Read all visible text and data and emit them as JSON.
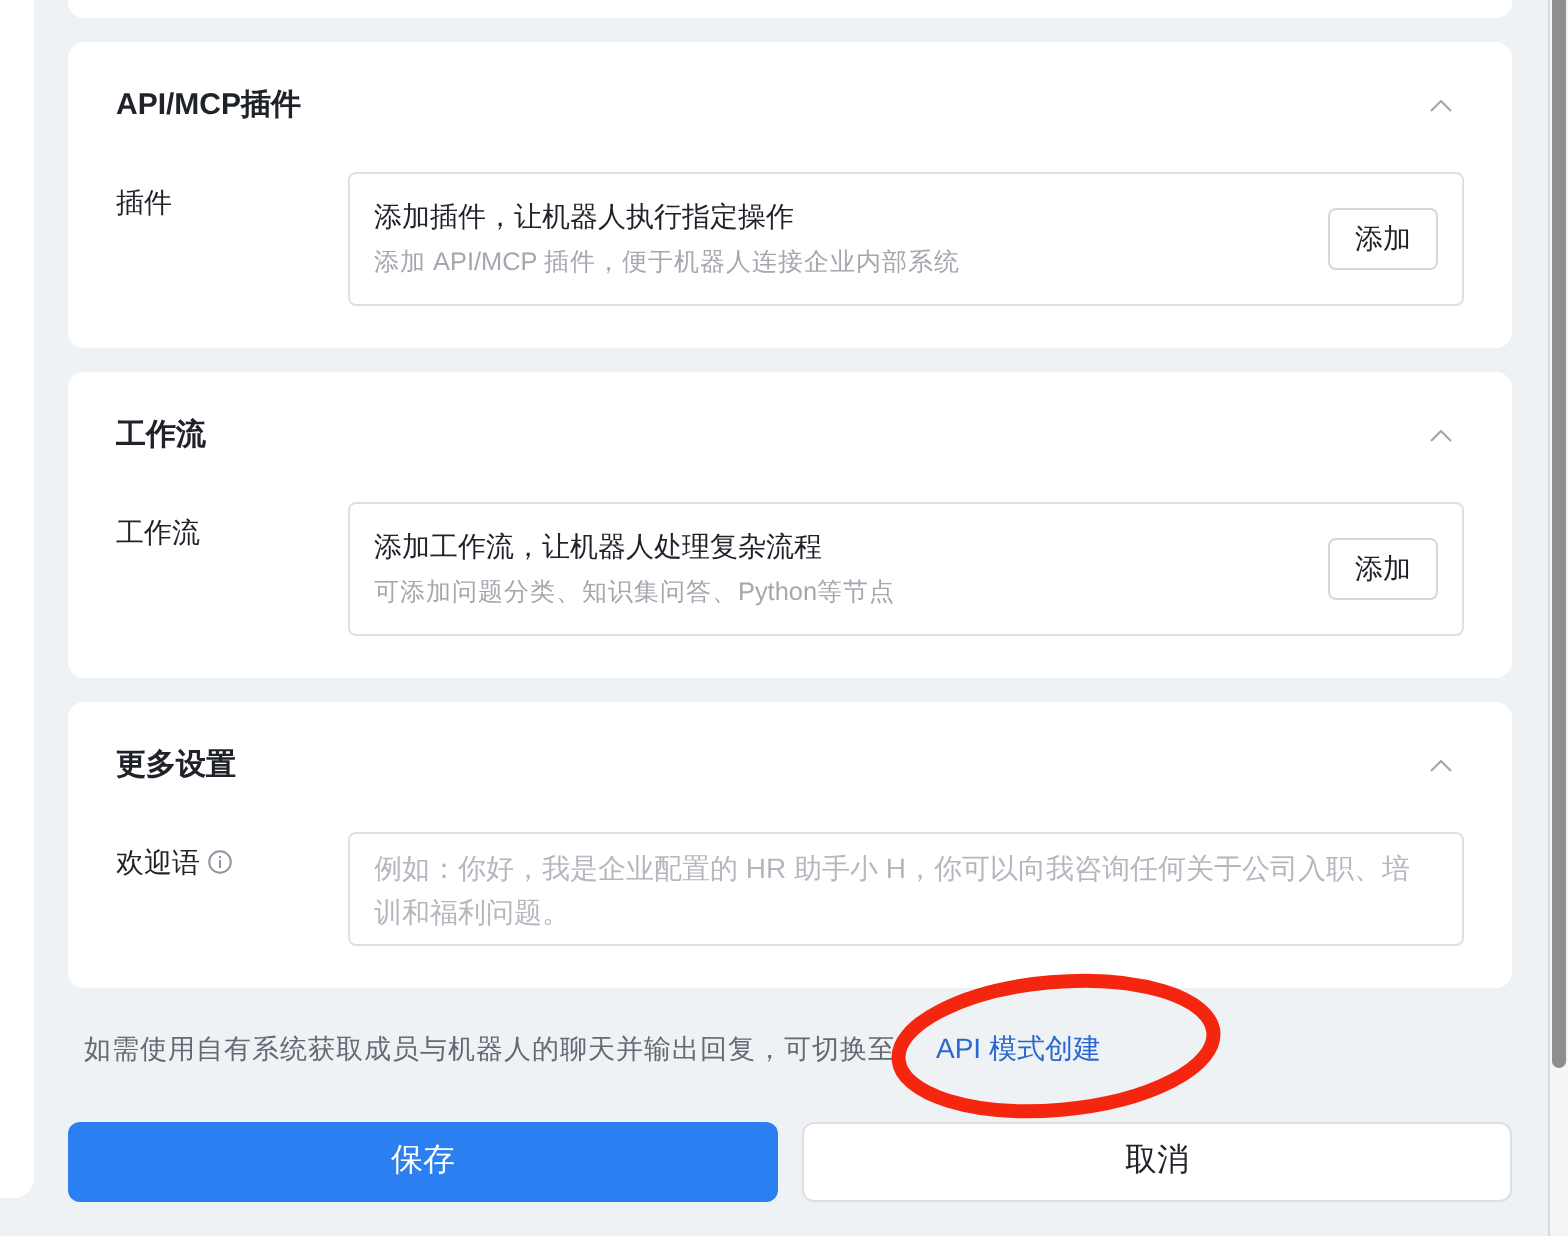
{
  "sections": [
    {
      "title": "API/MCP插件",
      "expanded": true,
      "rows": [
        {
          "kind": "add",
          "label": "插件",
          "info": false,
          "title": "添加插件，让机器人执行指定操作",
          "description": "添加 API/MCP 插件，便于机器人连接企业内部系统",
          "button": "添加"
        }
      ]
    },
    {
      "title": "工作流",
      "expanded": true,
      "rows": [
        {
          "kind": "add",
          "label": "工作流",
          "info": false,
          "title": "添加工作流，让机器人处理复杂流程",
          "description": "可添加问题分类、知识集问答、Python等节点",
          "button": "添加"
        }
      ]
    },
    {
      "title": "更多设置",
      "expanded": true,
      "rows": [
        {
          "kind": "textarea",
          "label": "欢迎语",
          "info": true,
          "placeholder": "例如：你好，我是企业配置的 HR 助手小 H，你可以向我咨询任何关于公司入职、培训和福利问题。"
        }
      ]
    }
  ],
  "note": {
    "text": "如需使用自有系统获取成员与机器人的聊天并输出回复，可切换至",
    "link": "API 模式创建",
    "highlight": {
      "kind": "ellipse"
    }
  },
  "buttons": [
    {
      "label": "保存",
      "kind": "primary"
    },
    {
      "label": "取消",
      "kind": "secondary"
    }
  ]
}
